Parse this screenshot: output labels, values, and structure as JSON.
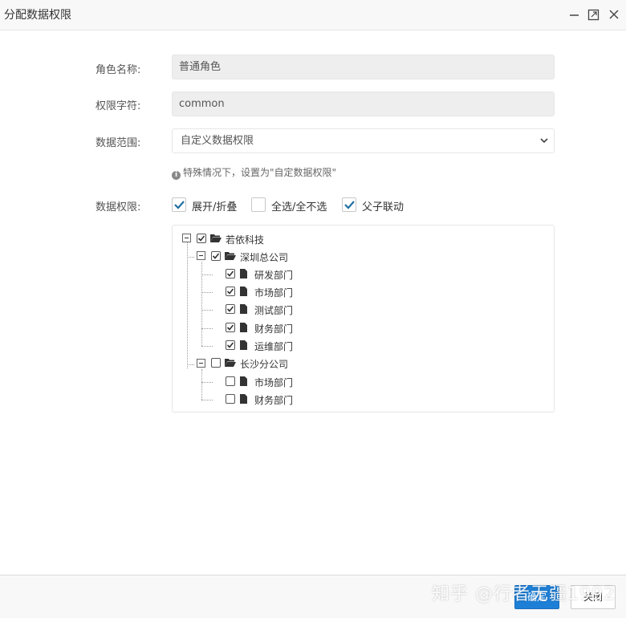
{
  "dialog": {
    "title": "分配数据权限",
    "icons": [
      "minimize-icon",
      "maximize-icon",
      "close-icon"
    ]
  },
  "form": {
    "role_name_label": "角色名称:",
    "role_name_value": "普通角色",
    "permission_key_label": "权限字符:",
    "permission_key_value": "common",
    "data_scope_label": "数据范围:",
    "data_scope_value": "自定义数据权限",
    "hint": "特殊情况下，设置为\"自定数据权限\"",
    "data_permission_label": "数据权限:",
    "options": [
      {
        "label": "展开/折叠",
        "checked": true
      },
      {
        "label": "全选/全不选",
        "checked": false
      },
      {
        "label": "父子联动",
        "checked": true
      }
    ]
  },
  "tree": {
    "root": {
      "label": "若依科技",
      "checked": true
    },
    "branches": [
      {
        "label": "深圳总公司",
        "checked": true,
        "children": [
          {
            "label": "研发部门",
            "checked": true
          },
          {
            "label": "市场部门",
            "checked": true
          },
          {
            "label": "测试部门",
            "checked": true
          },
          {
            "label": "财务部门",
            "checked": true
          },
          {
            "label": "运维部门",
            "checked": true
          }
        ]
      },
      {
        "label": "长沙分公司",
        "checked": false,
        "children": [
          {
            "label": "市场部门",
            "checked": false
          },
          {
            "label": "财务部门",
            "checked": false
          }
        ]
      }
    ]
  },
  "footer": {
    "confirm_label": "确定",
    "close_label": "关闭"
  },
  "watermark": "知乎 @行者无疆1992",
  "colors": {
    "accent": "#1e7fd6",
    "check": "#1f6fa3"
  }
}
